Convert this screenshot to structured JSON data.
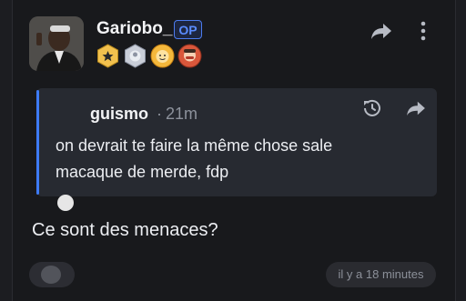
{
  "post": {
    "username": "Gariobo_",
    "op_label": "OP",
    "badges": [
      "star-badge-icon",
      "silver-badge-icon",
      "gold-face-badge-icon",
      "red-avatar-badge-icon"
    ]
  },
  "quote": {
    "username": "guismo",
    "separator": "·",
    "time": "21m",
    "line1": "on devrait te faire la même chose sale",
    "line2": "macaque de merde, fdp"
  },
  "comment": {
    "text": "Ce sont des menaces?",
    "timestamp": "il y a 18 minutes"
  },
  "colors": {
    "accent": "#3d7bf7",
    "background": "#18191c",
    "quote_background": "#272a31"
  }
}
